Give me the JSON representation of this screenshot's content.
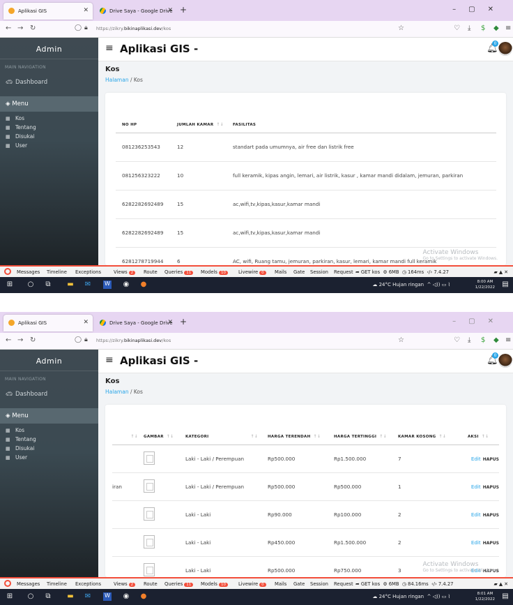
{
  "browser": {
    "tab1": "Aplikasi GIS",
    "tab2": "Drive Saya - Google Drive",
    "url_prefix": "https://zikry.",
    "url_host": "bikinaplikasi.dev",
    "url_path": "/kos"
  },
  "sidebar": {
    "brand": "Admin",
    "main_nav": "MAIN NAVIGATION",
    "dashboard": "Dashboard",
    "menu": "Menu",
    "items": [
      "Kos",
      "Tentang",
      "Disukai",
      "User"
    ]
  },
  "header": {
    "title": "Aplikasi GIS -",
    "bell_count": "0"
  },
  "page": {
    "title": "Kos",
    "crumb_link": "Halaman",
    "crumb_sep": " / ",
    "crumb_current": "Kos"
  },
  "table1": {
    "headers": [
      "NO HP",
      "JUMLAH KAMAR",
      "FASILITAS"
    ],
    "rows": [
      [
        "081236253543",
        "12",
        "standart pada umumnya, air free dan listrik free"
      ],
      [
        "081256323222",
        "10",
        "full keramik, kipas angin, lemari, air listrik, kasur , kamar mandi didalam, jemuran, parkiran"
      ],
      [
        "6282282692489",
        "15",
        "ac,wifi,tv,kipas,kasur,kamar mandi"
      ],
      [
        "6282282692489",
        "15",
        "ac,wifi,tv,kipas,kasur,kamar mandi"
      ],
      [
        "6281278719944",
        "6",
        "AC, wifi, Ruang tamu, jemuran, parkiran, kasur, lemari, kamar mandi full keramik"
      ]
    ]
  },
  "table2": {
    "headers": [
      "GAMBAR",
      "KATEGORI",
      "HARGA TERENDAH",
      "HARGA TERTINGGI",
      "KAMAR KOSONG",
      "AKSI"
    ],
    "rows": [
      [
        "",
        "Laki - Laki / Perempuan",
        "Rp500.000",
        "Rp1.500.000",
        "7"
      ],
      [
        "iran",
        "Laki - Laki / Perempuan",
        "Rp500.000",
        "Rp500.000",
        "1"
      ],
      [
        "",
        "Laki - Laki",
        "Rp90.000",
        "Rp100.000",
        "2"
      ],
      [
        "",
        "Laki - Laki",
        "Rp450.000",
        "Rp1.500.000",
        "2"
      ],
      [
        "",
        "Laki - Laki",
        "Rp500.000",
        "Rp750.000",
        "3"
      ]
    ],
    "edit": "Edit",
    "hapus": "HAPUS"
  },
  "watermark": {
    "title": "Activate Windows",
    "sub": "Go to Settings to activate Windows."
  },
  "debugbar": {
    "items": [
      "Messages",
      "Timeline",
      "Exceptions",
      "Views",
      "Route",
      "Queries",
      "Models",
      "Livewire",
      "Mails",
      "Gate",
      "Session",
      "Request"
    ],
    "views_count": "2",
    "queries_count": "11",
    "models_count": "10",
    "livewire_count": "0",
    "right1": "GET kos",
    "mem": "6MB",
    "time1": "164ms",
    "time2": "84.16ms",
    "php": "7.4.27"
  },
  "taskbar": {
    "weather": "24°C Hujan ringan",
    "time1": "8:00 AM",
    "time2": "8:01 AM",
    "date": "1/22/2022"
  }
}
